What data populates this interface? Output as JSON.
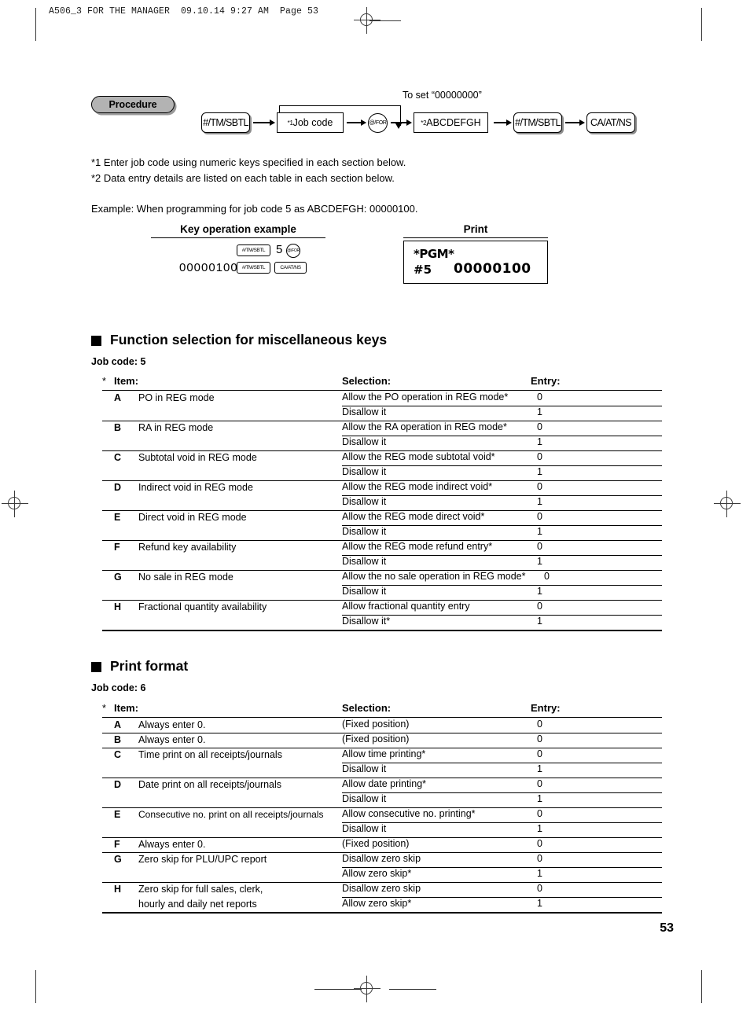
{
  "running_head": "A506_3 FOR THE MANAGER  09.10.14 9:27 AM  Page 53",
  "procedure": {
    "badge_label": "Procedure",
    "bypass_label": "To set “00000000”",
    "steps": [
      {
        "key": "#/TM/SBTL",
        "shape": "rounded"
      },
      {
        "sup": "*1",
        "key": "Job code",
        "shape": "square"
      },
      {
        "key": "@/FOR",
        "shape": "circle"
      },
      {
        "sup": "*2",
        "key": "ABCDEFGH",
        "shape": "square"
      },
      {
        "key": "#/TM/SBTL",
        "shape": "rounded"
      },
      {
        "key": "CA/AT/NS",
        "shape": "rounded"
      }
    ]
  },
  "footnotes": [
    "*1  Enter job code using numeric keys specified in each section below.",
    "*2  Data entry details are listed on each table in each section below."
  ],
  "example_line": "Example:  When programming for job code 5 as ABCDEFGH: 00000100.",
  "example": {
    "key_operation_header": "Key operation example",
    "print_header": "Print",
    "amount": "00000100",
    "keys_row1": [
      "#/TM/SBTL",
      "5",
      "@/FOR"
    ],
    "keys_row2": [
      "#/TM/SBTL",
      "CA/AT/NS"
    ],
    "print_line1": "*PGM*",
    "print_line2_label": "#5",
    "print_line2_value": "00000100"
  },
  "sections": [
    {
      "title": "Function selection for miscellaneous keys",
      "job_code_label": "Job code:  5",
      "headers": {
        "star": "*",
        "item": "Item:",
        "selection": "Selection:",
        "entry": "Entry:"
      },
      "rows": [
        {
          "letter": "A",
          "item": "PO in REG mode",
          "options": [
            {
              "selection": "Allow the PO operation in REG mode*",
              "entry": "0"
            },
            {
              "selection": "Disallow it",
              "entry": "1"
            }
          ]
        },
        {
          "letter": "B",
          "item": "RA in REG mode",
          "options": [
            {
              "selection": "Allow the RA operation in REG mode*",
              "entry": "0"
            },
            {
              "selection": "Disallow it",
              "entry": "1"
            }
          ]
        },
        {
          "letter": "C",
          "item": "Subtotal void in REG mode",
          "options": [
            {
              "selection": "Allow the REG mode subtotal void*",
              "entry": "0"
            },
            {
              "selection": "Disallow it",
              "entry": "1"
            }
          ]
        },
        {
          "letter": "D",
          "item": "Indirect void in REG mode",
          "options": [
            {
              "selection": "Allow the REG mode indirect void*",
              "entry": "0"
            },
            {
              "selection": "Disallow it",
              "entry": "1"
            }
          ]
        },
        {
          "letter": "E",
          "item": "Direct void in REG mode",
          "options": [
            {
              "selection": "Allow the REG mode direct void*",
              "entry": "0"
            },
            {
              "selection": "Disallow it",
              "entry": "1"
            }
          ]
        },
        {
          "letter": "F",
          "item": "Refund key availability",
          "options": [
            {
              "selection": "Allow the REG mode refund entry*",
              "entry": "0"
            },
            {
              "selection": "Disallow it",
              "entry": "1"
            }
          ]
        },
        {
          "letter": "G",
          "item": "No sale in REG mode",
          "options": [
            {
              "selection": "Allow the no sale operation in REG mode*",
              "entry": "0"
            },
            {
              "selection": "Disallow it",
              "entry": "1"
            }
          ]
        },
        {
          "letter": "H",
          "item": "Fractional quantity availability",
          "options": [
            {
              "selection": "Allow fractional quantity entry",
              "entry": "0"
            },
            {
              "selection": "Disallow it*",
              "entry": "1"
            }
          ]
        }
      ]
    },
    {
      "title": "Print format",
      "job_code_label": "Job code:  6",
      "headers": {
        "star": "*",
        "item": "Item:",
        "selection": "Selection:",
        "entry": "Entry:"
      },
      "rows": [
        {
          "letter": "A",
          "item": "Always enter 0.",
          "options": [
            {
              "selection": "(Fixed position)",
              "entry": "0"
            }
          ]
        },
        {
          "letter": "B",
          "item": "Always enter 0.",
          "options": [
            {
              "selection": "(Fixed position)",
              "entry": "0"
            }
          ]
        },
        {
          "letter": "C",
          "item": "Time print on all receipts/journals",
          "options": [
            {
              "selection": "Allow time printing*",
              "entry": "0"
            },
            {
              "selection": "Disallow it",
              "entry": "1"
            }
          ]
        },
        {
          "letter": "D",
          "item": "Date print on all receipts/journals",
          "options": [
            {
              "selection": "Allow date printing*",
              "entry": "0"
            },
            {
              "selection": "Disallow it",
              "entry": "1"
            }
          ]
        },
        {
          "letter": "E",
          "item": "Consecutive no. print on all receipts/journals",
          "options": [
            {
              "selection": "Allow consecutive no. printing*",
              "entry": "0"
            },
            {
              "selection": "Disallow it",
              "entry": "1"
            }
          ]
        },
        {
          "letter": "F",
          "item": "Always enter 0.",
          "options": [
            {
              "selection": "(Fixed position)",
              "entry": "0"
            }
          ]
        },
        {
          "letter": "G",
          "item": "Zero skip for PLU/UPC report",
          "options": [
            {
              "selection": "Disallow zero skip",
              "entry": "0"
            },
            {
              "selection": "Allow zero skip*",
              "entry": "1"
            }
          ]
        },
        {
          "letter": "H",
          "item": "Zero skip for full sales, clerk,",
          "item2": "hourly and daily net reports",
          "options": [
            {
              "selection": "Disallow zero skip",
              "entry": "0"
            },
            {
              "selection": "Allow zero skip*",
              "entry": "1"
            }
          ]
        }
      ]
    }
  ],
  "page_number": "53"
}
